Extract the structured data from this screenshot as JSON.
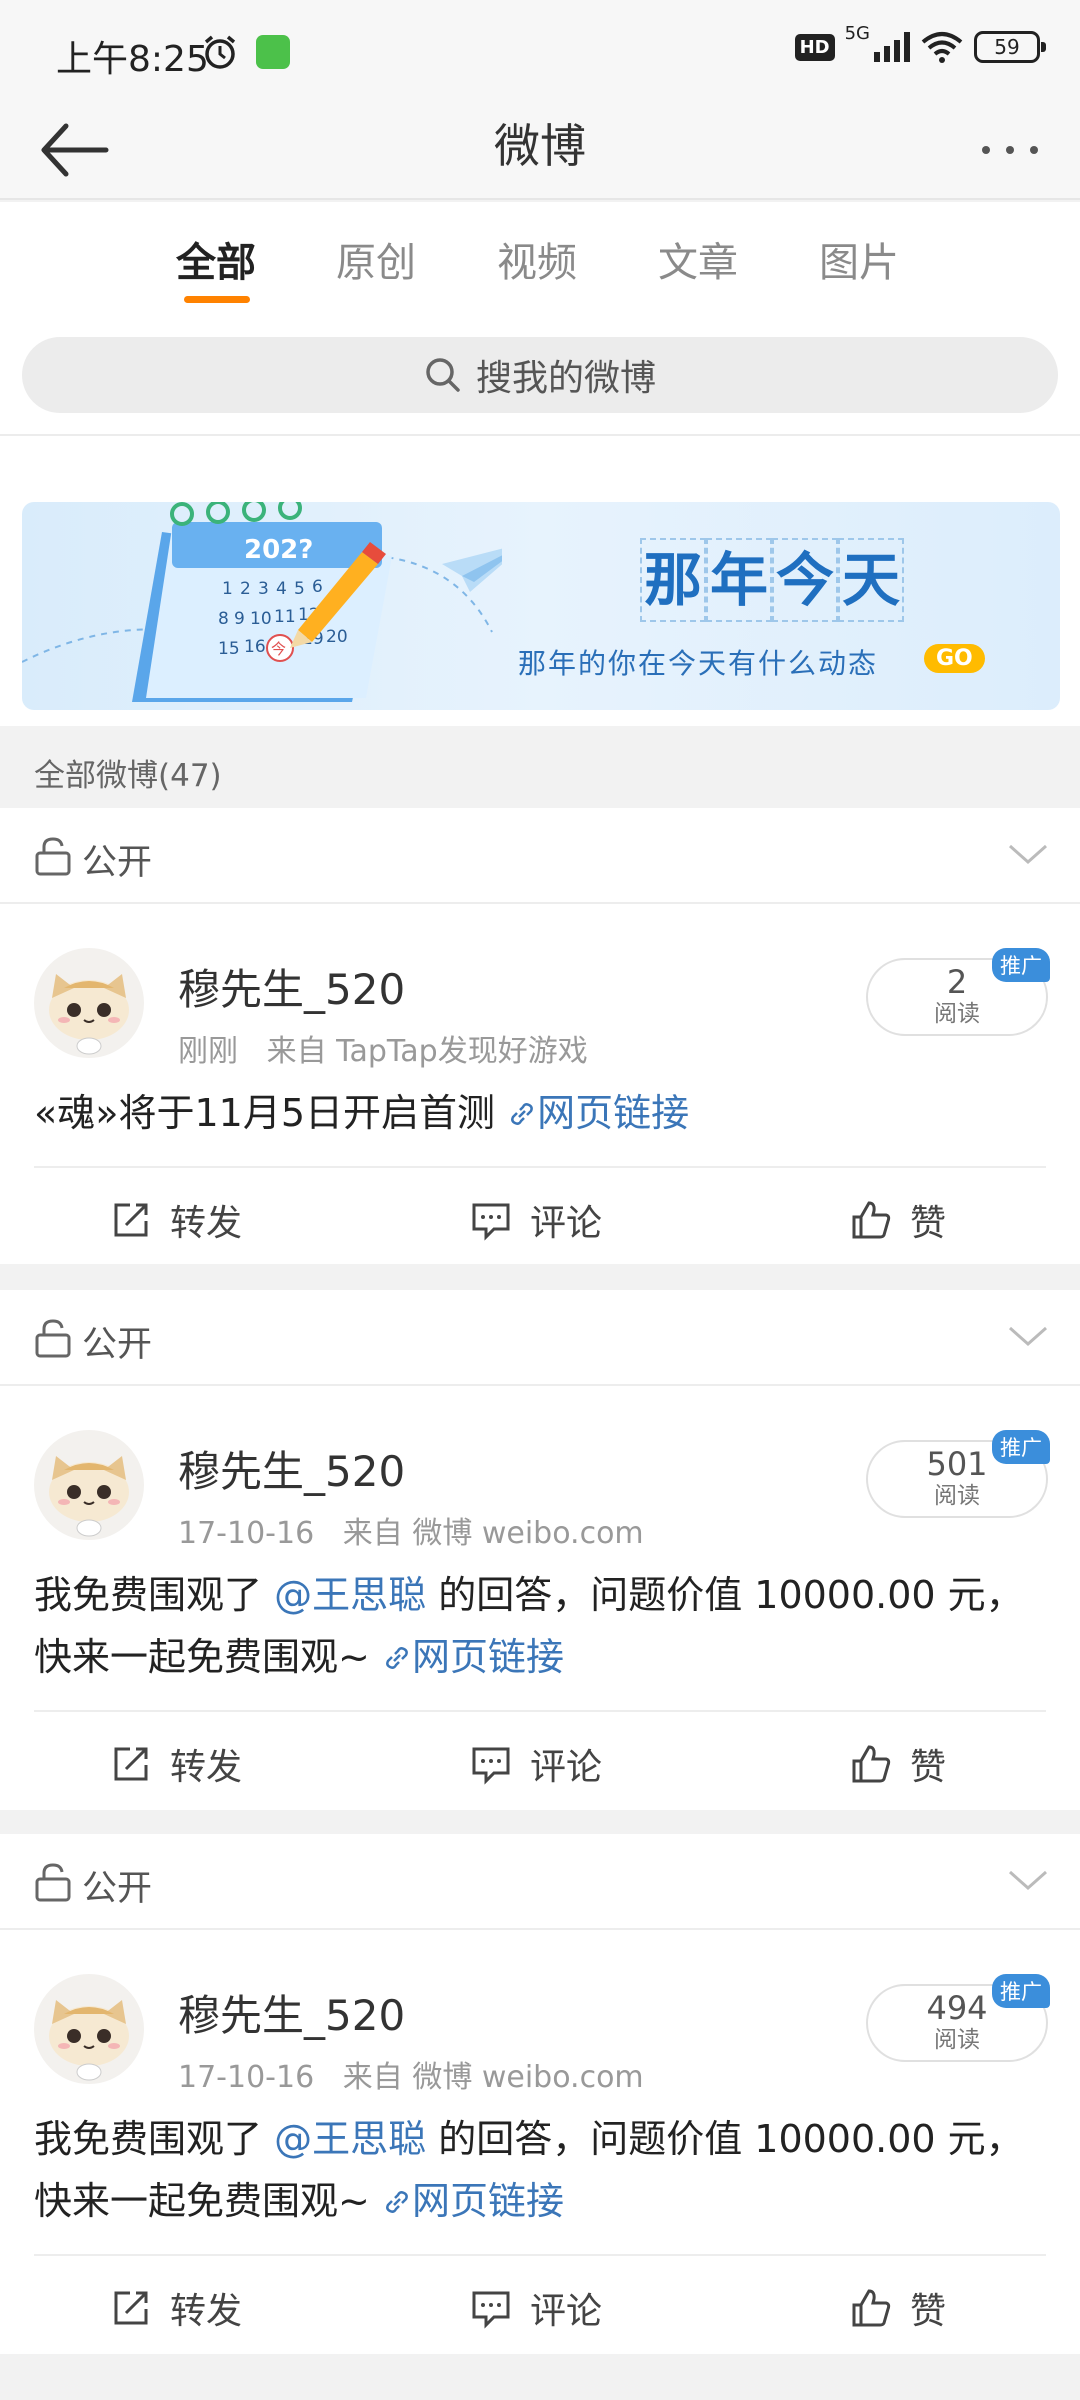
{
  "status_bar": {
    "time": "上午8:25",
    "hd": "HD",
    "network": "5G",
    "battery": "59"
  },
  "nav": {
    "title": "微博"
  },
  "tabs": [
    {
      "label": "全部",
      "active": true
    },
    {
      "label": "原创",
      "active": false
    },
    {
      "label": "视频",
      "active": false
    },
    {
      "label": "文章",
      "active": false
    },
    {
      "label": "图片",
      "active": false
    }
  ],
  "search": {
    "placeholder": "搜我的微博"
  },
  "banner": {
    "title_chars": [
      "那",
      "年",
      "今",
      "天"
    ],
    "subtitle": "那年的你在今天有什么动态",
    "go": "GO",
    "calendar_year": "202?",
    "calendar_days": [
      "1",
      "2",
      "3",
      "4",
      "5",
      "6",
      "8",
      "9",
      "10",
      "11",
      "12",
      "15",
      "16",
      "今",
      "19",
      "20"
    ]
  },
  "section": {
    "title": "全部微博(47)"
  },
  "posts": [
    {
      "privacy": "公开",
      "username": "穆先生_520",
      "time": "刚刚",
      "source": "来自 TapTap发现好游戏",
      "read_count": "2",
      "read_label": "阅读",
      "promo": "推广",
      "text_before": "«魂»将于11月5日开启首测",
      "mention": "",
      "text_after": "",
      "link": "网页链接",
      "actions": {
        "repost": "转发",
        "comment": "评论",
        "like": "赞"
      }
    },
    {
      "privacy": "公开",
      "username": "穆先生_520",
      "time": "17-10-16",
      "source": "来自 微博 weibo.com",
      "read_count": "501",
      "read_label": "阅读",
      "promo": "推广",
      "text_before": "我免费围观了 ",
      "mention": "@王思聪",
      "text_after": " 的回答，问题价值 10000.00 元，快来一起免费围观~",
      "link": "网页链接",
      "actions": {
        "repost": "转发",
        "comment": "评论",
        "like": "赞"
      }
    },
    {
      "privacy": "公开",
      "username": "穆先生_520",
      "time": "17-10-16",
      "source": "来自 微博 weibo.com",
      "read_count": "494",
      "read_label": "阅读",
      "promo": "推广",
      "text_before": "我免费围观了 ",
      "mention": "@王思聪",
      "text_after": " 的回答，问题价值 10000.00 元，快来一起免费围观~",
      "link": "网页链接",
      "actions": {
        "repost": "转发",
        "comment": "评论",
        "like": "赞"
      }
    }
  ],
  "colors": {
    "accent": "#ff8200",
    "link": "#3b76b8",
    "promo": "#3b8edb"
  }
}
